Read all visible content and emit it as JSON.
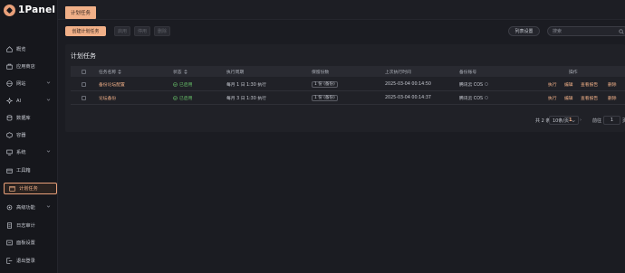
{
  "app": {
    "name": "1Panel",
    "active_tab": "计划任务"
  },
  "sidebar": {
    "items": [
      {
        "label": "概览",
        "icon": "home-icon",
        "has_arrow": false
      },
      {
        "label": "应用商店",
        "icon": "store-icon",
        "has_arrow": false
      },
      {
        "label": "网站",
        "icon": "globe-icon",
        "has_arrow": true
      },
      {
        "label": "AI",
        "icon": "ai-icon",
        "has_arrow": true
      },
      {
        "label": "数据库",
        "icon": "database-icon",
        "has_arrow": false
      },
      {
        "label": "容器",
        "icon": "container-icon",
        "has_arrow": false
      },
      {
        "label": "系统",
        "icon": "system-icon",
        "has_arrow": true
      },
      {
        "label": "工具箱",
        "icon": "toolbox-icon",
        "has_arrow": false
      },
      {
        "label": "计划任务",
        "icon": "calendar-icon",
        "has_arrow": false,
        "active": true
      },
      {
        "label": "高级功能",
        "icon": "advanced-icon",
        "has_arrow": true
      },
      {
        "label": "日志审计",
        "icon": "log-icon",
        "has_arrow": false
      },
      {
        "label": "面板设置",
        "icon": "settings-icon",
        "has_arrow": false
      },
      {
        "label": "退出登录",
        "icon": "logout-icon",
        "has_arrow": false
      }
    ]
  },
  "toolbar": {
    "create_label": "创建计划任务",
    "enable_label": "启用",
    "disable_label": "停用",
    "delete_label": "删除",
    "settings_label": "列表设置",
    "search_placeholder": "搜索"
  },
  "card": {
    "title": "计划任务"
  },
  "table": {
    "headers": {
      "name": "任务名称",
      "status": "状态",
      "period": "执行周期",
      "retain": "保留份数",
      "last_run": "上次执行时间",
      "backup": "备份账号",
      "ops": "操作"
    },
    "rows": [
      {
        "name": "备份论坛配置",
        "status": "已启用",
        "period": "每月 1 日 1:30 执行",
        "retain": "1 份 (备份)",
        "last_run": "2025-03-04 00:14:50",
        "backup": "腾讯云 COS",
        "ops": [
          "执行",
          "编辑",
          "查看报告",
          "删除"
        ]
      },
      {
        "name": "论坛备份",
        "status": "已启用",
        "period": "每月 3 日 1:30 执行",
        "retain": "1 份 (备份)",
        "last_run": "2025-03-04 00:14:37",
        "backup": "腾讯云 COS",
        "ops": [
          "执行",
          "编辑",
          "查看报告",
          "删除"
        ]
      }
    ]
  },
  "pagination": {
    "total": "共 2 条",
    "page_size": "10条/页",
    "current_page": "1",
    "goto_label": "前往",
    "goto_value": "1",
    "page_suffix": "页"
  },
  "colors": {
    "accent": "#f1b088",
    "enabled": "#68c26a",
    "background": "#1b1c22"
  }
}
